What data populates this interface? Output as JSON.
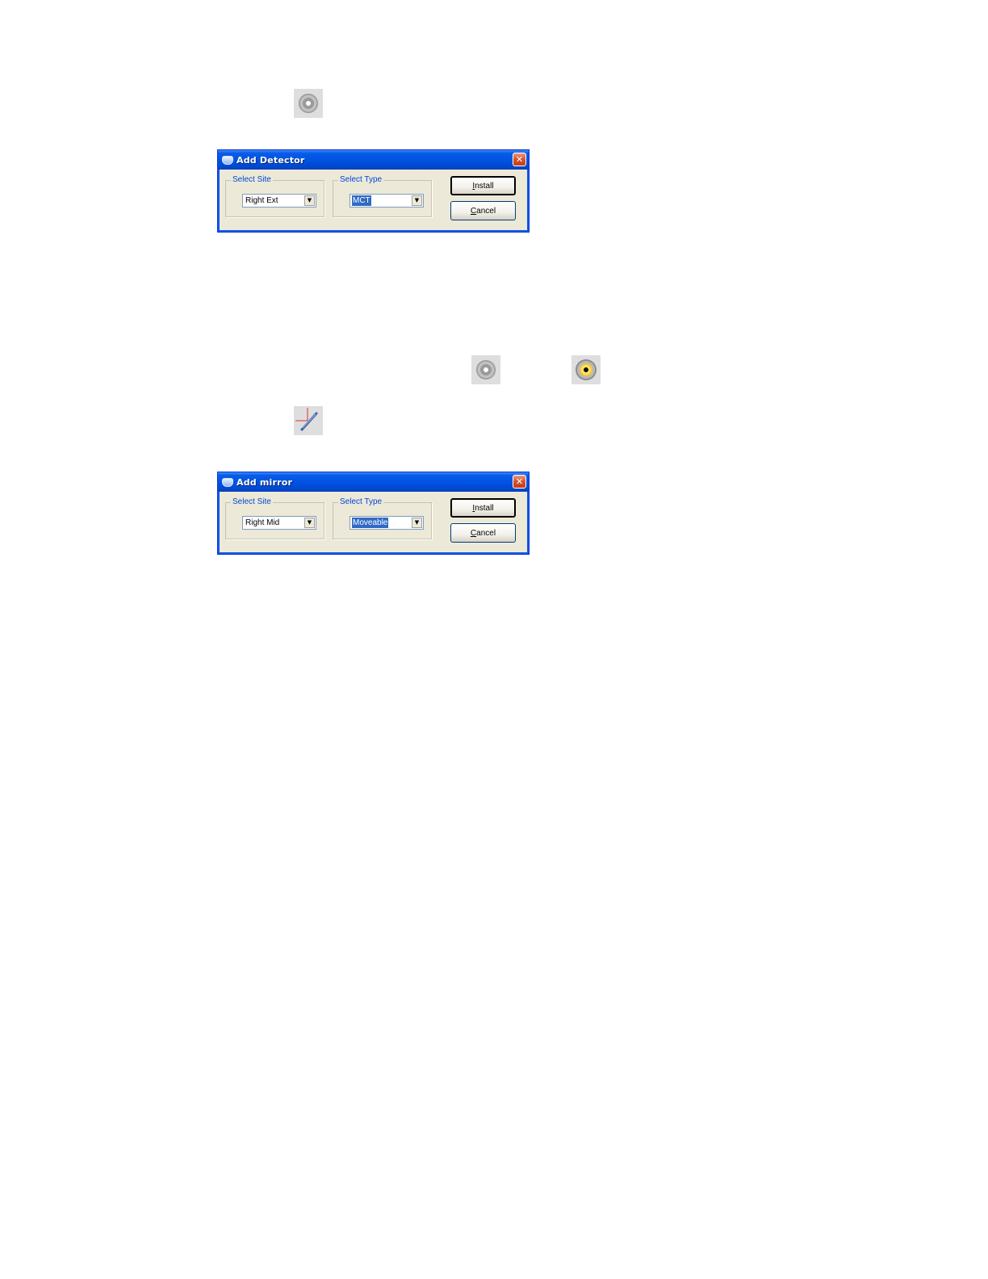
{
  "detector_dialog": {
    "title": "Add Detector",
    "site_group_label": "Select Site",
    "site_value": "Right Ext",
    "type_group_label": "Select Type",
    "type_value": "MCT",
    "install_mnemonic": "I",
    "install_rest": "nstall",
    "cancel_mnemonic": "C",
    "cancel_rest": "ancel"
  },
  "mirror_dialog": {
    "title": "Add mirror",
    "site_group_label": "Select Site",
    "site_value": "Right Mid",
    "type_group_label": "Select Type",
    "type_value": "Moveable",
    "install_mnemonic": "I",
    "install_rest": "nstall",
    "cancel_mnemonic": "C",
    "cancel_rest": "ancel"
  },
  "icons": {
    "detector_tool": "detector-icon",
    "detector_inactive": "detector-inactive-icon",
    "detector_active": "detector-active-icon",
    "mirror_tool": "mirror-icon"
  },
  "colors": {
    "titlebar": "#0054e3",
    "dialog_bg": "#ece9d8",
    "selection": "#316ac5",
    "groupbox_label": "#0046d5"
  }
}
